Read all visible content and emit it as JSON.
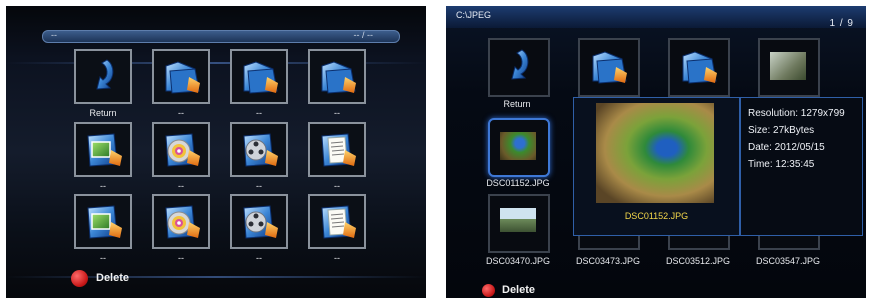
{
  "left_panel": {
    "path_left": "--",
    "path_right": "-- / --",
    "return_label": "Return",
    "item_labels": [
      "--",
      "--",
      "--",
      "--",
      "--",
      "--",
      "--",
      "--",
      "--",
      "--",
      "--"
    ],
    "delete_label": "Delete"
  },
  "right_panel": {
    "path": "C:\\JPEG",
    "page_indicator": "1 / 9",
    "return_label": "Return",
    "files": [
      "DSC01152.JPG",
      "DSC03470.JPG",
      "DSC03473.JPG",
      "DSC03512.JPG",
      "DSC03547.JPG"
    ],
    "preview_caption": "DSC01152.JPG",
    "info": {
      "resolution": "Resolution: 1279x799",
      "size": "Size: 27kBytes",
      "date": "Date: 2012/05/15",
      "time": "Time: 12:35:45"
    },
    "delete_label": "Delete"
  },
  "colors": {
    "accent_blue": "#2f5fa8",
    "selection_blue": "#3e78d6",
    "delete_red": "#d41b1b",
    "preview_caption": "#f5d84a"
  },
  "icons": {
    "return": "return-arrow-icon",
    "folder": "folder-icon",
    "photo_file": "photo-file-icon",
    "music_file": "music-disc-icon",
    "video_file": "film-reel-icon",
    "text_file": "text-document-icon"
  }
}
